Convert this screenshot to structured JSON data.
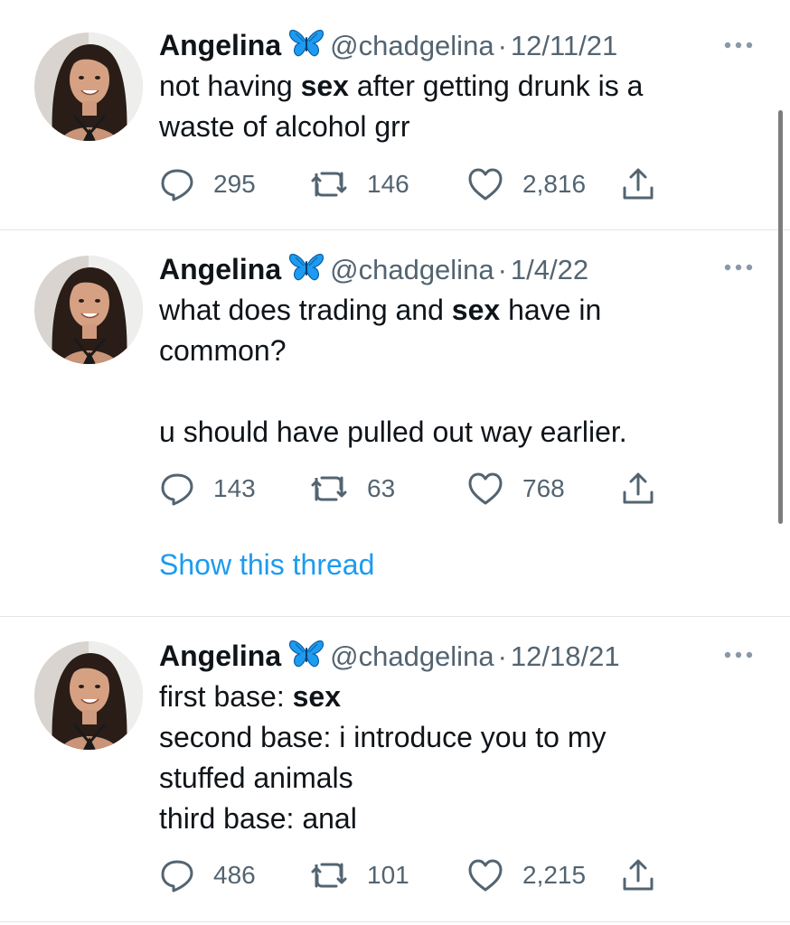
{
  "tweets": [
    {
      "display_name": "Angelina",
      "handle": "@chadgelina",
      "separator": "·",
      "date": "12/11/21",
      "text_segments": [
        "not having ",
        "sex",
        " after getting drunk is a\nwaste of alcohol grr"
      ],
      "replies": "295",
      "retweets": "146",
      "likes": "2,816"
    },
    {
      "display_name": "Angelina",
      "handle": "@chadgelina",
      "separator": "·",
      "date": "1/4/22",
      "text_segments": [
        "what does trading and ",
        "sex",
        " have in\ncommon?\n\nu should have pulled out way earlier."
      ],
      "replies": "143",
      "retweets": "63",
      "likes": "768",
      "thread_link": "Show this thread"
    },
    {
      "display_name": "Angelina",
      "handle": "@chadgelina",
      "separator": "·",
      "date": "12/18/21",
      "text_segments": [
        "first base: ",
        "sex",
        "\nsecond base: i introduce you to my\nstuffed animals\nthird base: anal"
      ],
      "replies": "486",
      "retweets": "101",
      "likes": "2,215"
    }
  ],
  "icons": {
    "verified_badge": "butterfly-icon",
    "more": "more-icon",
    "reply": "reply-icon",
    "retweet": "retweet-icon",
    "like": "heart-icon",
    "share": "share-icon"
  },
  "colors": {
    "link": "#1d9bf0",
    "secondary_text": "#536471",
    "badge": "#1d9bf0",
    "divider": "#e1e6ea"
  }
}
